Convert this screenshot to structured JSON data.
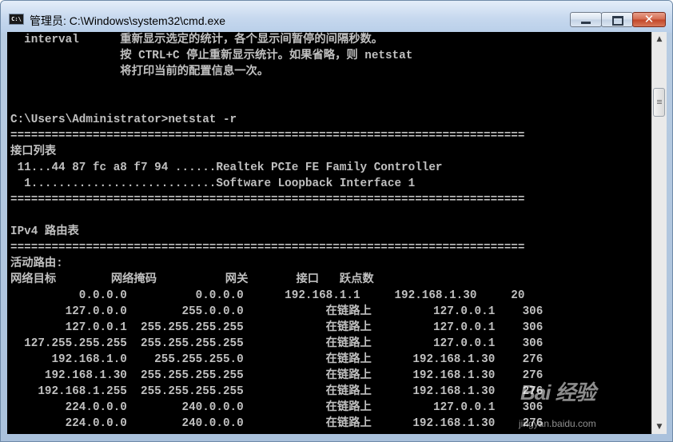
{
  "window": {
    "title": "管理员: C:\\Windows\\system32\\cmd.exe",
    "close_glyph": "✕"
  },
  "console": {
    "text": "  interval      重新显示选定的统计，各个显示间暂停的间隔秒数。\n                按 CTRL+C 停止重新显示统计。如果省略，则 netstat\n                将打印当前的配置信息一次。\n\n\nC:\\Users\\Administrator>netstat -r\n===========================================================================\n接口列表\n 11...44 87 fc a8 f7 94 ......Realtek PCIe FE Family Controller\n  1...........................Software Loopback Interface 1\n===========================================================================\n\nIPv4 路由表\n===========================================================================\n活动路由:\n网络目标        网络掩码          网关       接口   跃点数\n          0.0.0.0          0.0.0.0      192.168.1.1     192.168.1.30     20\n        127.0.0.0        255.0.0.0            在链路上         127.0.0.1    306\n        127.0.0.1  255.255.255.255            在链路上         127.0.0.1    306\n  127.255.255.255  255.255.255.255            在链路上         127.0.0.1    306\n      192.168.1.0    255.255.255.0            在链路上      192.168.1.30    276\n     192.168.1.30  255.255.255.255            在链路上      192.168.1.30    276\n    192.168.1.255  255.255.255.255            在链路上      192.168.1.30    276\n        224.0.0.0        240.0.0.0            在链路上         127.0.0.1    306\n        224.0.0.0        240.0.0.0            在链路上      192.168.1.30    276"
  },
  "watermark": {
    "logo": "Bai 经验",
    "site": "jingyan.baidu.com"
  }
}
